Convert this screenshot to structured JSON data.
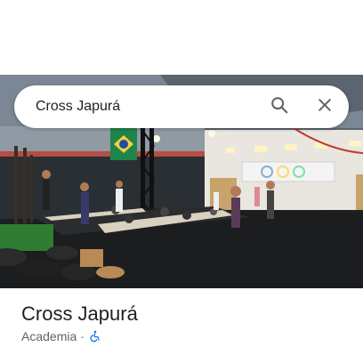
{
  "search": {
    "query": "Cross Japurá",
    "search_icon": "search-icon",
    "close_icon": "close-icon"
  },
  "photo": {
    "description_icon": "place-photo"
  },
  "place": {
    "name": "Cross Japurá",
    "category": "Academia",
    "separator": "·",
    "accessibility_icon": "wheelchair-accessible-icon",
    "accessibility_color": "#1a73e8"
  }
}
